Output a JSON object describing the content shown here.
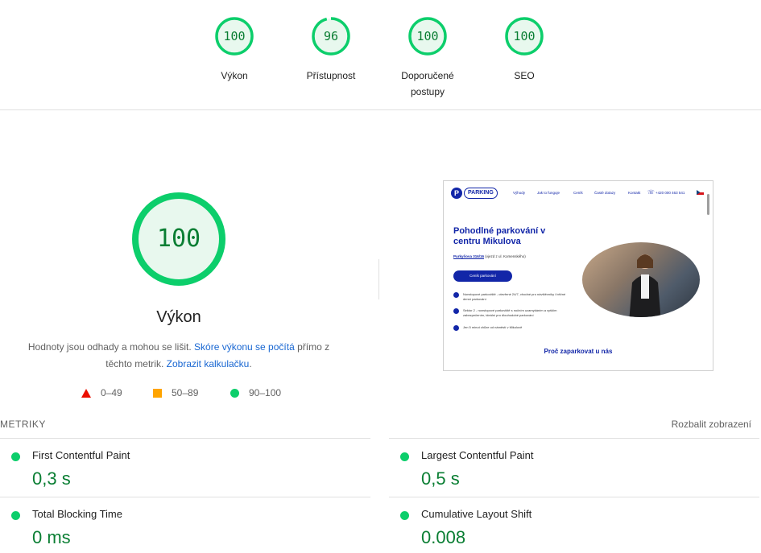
{
  "top_gauges": [
    {
      "score": "100",
      "label": "Výkon",
      "value": 100
    },
    {
      "score": "96",
      "label": "Přístupnost",
      "value": 96
    },
    {
      "score": "100",
      "label": "Doporučené postupy",
      "value": 100
    },
    {
      "score": "100",
      "label": "SEO",
      "value": 100
    }
  ],
  "performance": {
    "score": "100",
    "value": 100,
    "title": "Výkon",
    "desc_prefix": "Hodnoty jsou odhady a mohou se lišit. ",
    "desc_link1": "Skóre výkonu se počítá",
    "desc_mid": " přímo z těchto metrik. ",
    "desc_link2": "Zobrazit kalkulačku",
    "desc_suffix": "."
  },
  "legend": {
    "fail": "0–49",
    "average": "50–89",
    "pass": "90–100"
  },
  "preview": {
    "logo_letter": "P",
    "logo_text": "PARKING",
    "menu": [
      "Výhody",
      "Jak to funguje",
      "Ceník",
      "Časté dotazy",
      "Kontakt",
      "+420 000 463 541"
    ],
    "heading": "Pohodlné parkování v centru Mikulova",
    "address_bold": "Purkyňova 316/16",
    "address_rest": " (vjezd z ul. Komenského)",
    "button": "Ceník parkování",
    "bullets": [
      "Nonstopové parkoviště - otevřené 24/7, vhodné pro návštěvníky i běžné denní parkování",
      "Sektor 2 - nonstopové parkoviště s nočním uzamykáním a vyšším zabezpečením, ideální pro dlouhodobé parkování",
      "Jen 5 minut chůze od náměstí v Mikulově"
    ],
    "footer_heading": "Proč zaparkovat u nás"
  },
  "metrics": {
    "title": "METRIKY",
    "expand": "Rozbalit zobrazení",
    "items": [
      {
        "name": "First Contentful Paint",
        "value": "0,3 s"
      },
      {
        "name": "Largest Contentful Paint",
        "value": "0,5 s"
      },
      {
        "name": "Total Blocking Time",
        "value": "0 ms"
      },
      {
        "name": "Cumulative Layout Shift",
        "value": "0.008"
      }
    ]
  },
  "colors": {
    "pass": "#0cce6b",
    "pass_text": "#0a7e33",
    "pass_bg": "#e8f8ee",
    "average": "#ffa400",
    "fail": "#eb0f00",
    "link": "#1967d2",
    "brand": "#1226a8"
  },
  "icons": [
    "fail-triangle-icon",
    "average-square-icon",
    "pass-circle-icon",
    "whatsapp-icon",
    "czech-flag-icon"
  ]
}
